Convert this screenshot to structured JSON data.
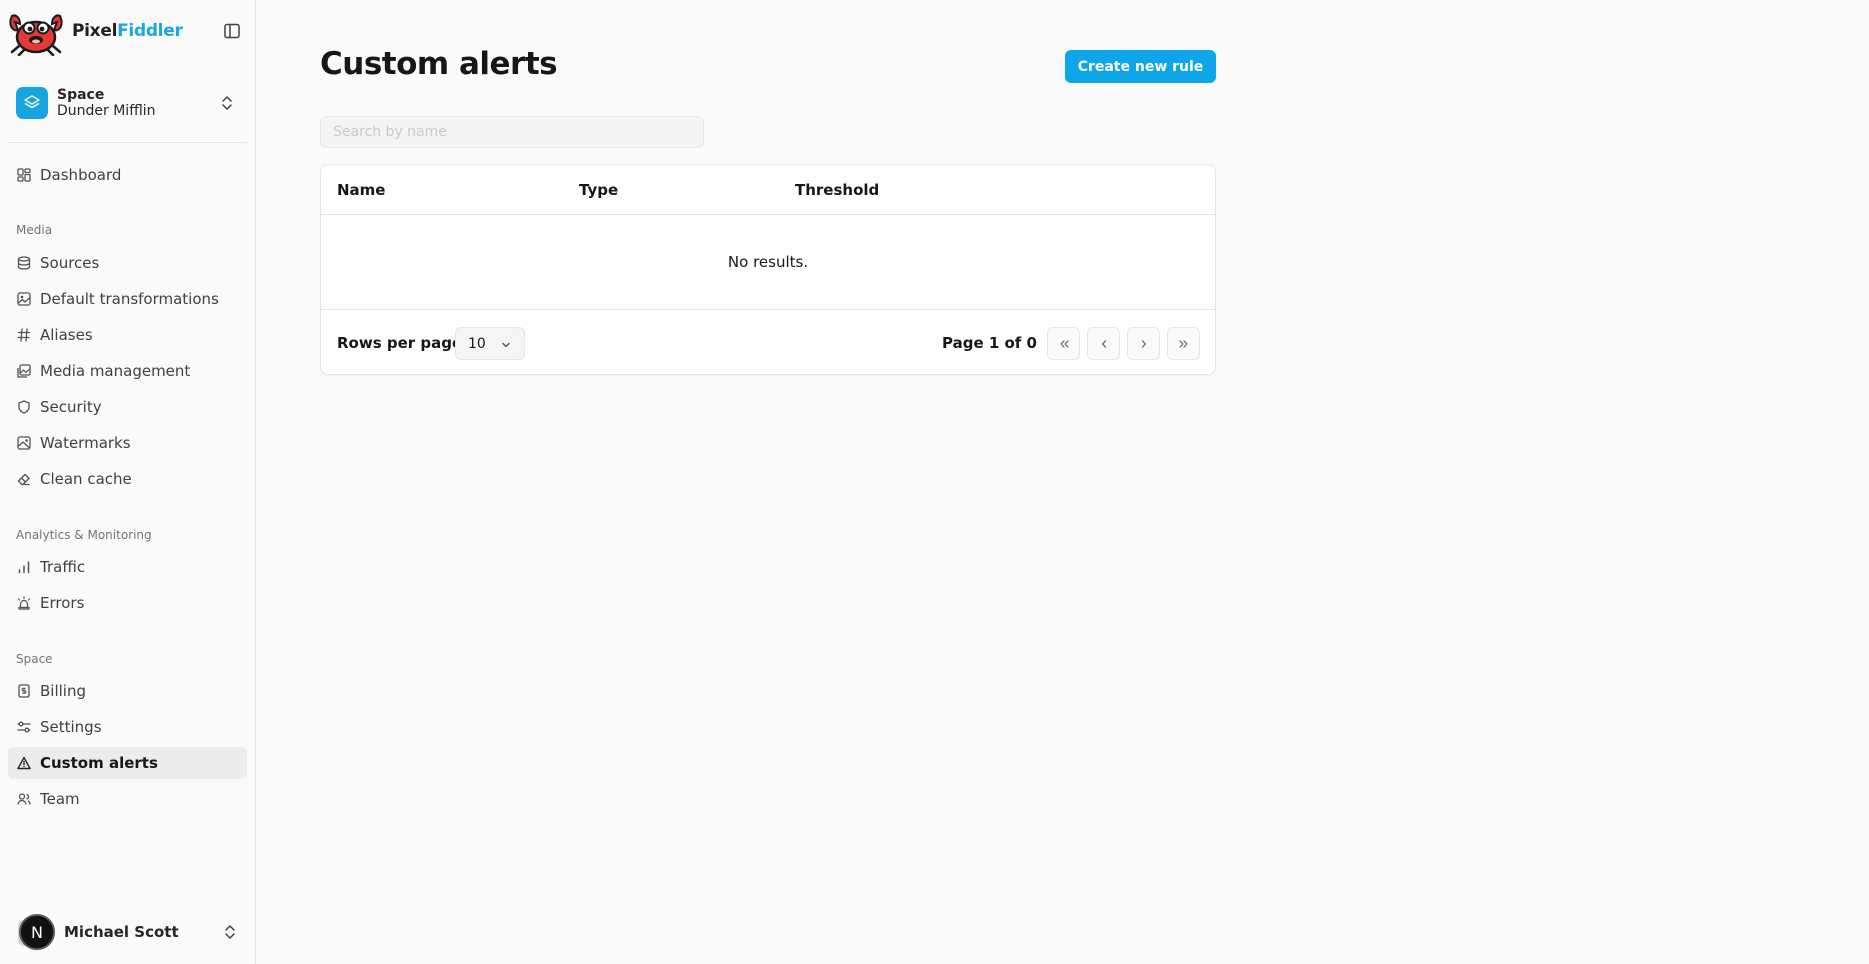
{
  "brand": {
    "name_part1": "Pixel",
    "name_part2": "Fiddler"
  },
  "space": {
    "label": "Space",
    "name": "Dunder Mifflin"
  },
  "nav": {
    "dashboard": {
      "label": "Dashboard",
      "icon": "dashboard-icon"
    },
    "groups": [
      {
        "label": "Media",
        "items": [
          {
            "label": "Sources",
            "icon": "database-icon"
          },
          {
            "label": "Default transformations",
            "icon": "image-transform-icon"
          },
          {
            "label": "Aliases",
            "icon": "hash-icon"
          },
          {
            "label": "Media management",
            "icon": "images-icon"
          },
          {
            "label": "Security",
            "icon": "shield-icon"
          },
          {
            "label": "Watermarks",
            "icon": "image-watermark-icon"
          },
          {
            "label": "Clean cache",
            "icon": "eraser-icon"
          }
        ]
      },
      {
        "label": "Analytics & Monitoring",
        "items": [
          {
            "label": "Traffic",
            "icon": "bar-chart-icon"
          },
          {
            "label": "Errors",
            "icon": "siren-icon"
          }
        ]
      },
      {
        "label": "Space",
        "items": [
          {
            "label": "Billing",
            "icon": "receipt-icon"
          },
          {
            "label": "Settings",
            "icon": "sliders-icon"
          },
          {
            "label": "Custom alerts",
            "icon": "alert-triangle-icon",
            "active": true
          },
          {
            "label": "Team",
            "icon": "users-icon"
          }
        ]
      }
    ]
  },
  "user": {
    "name": "Michael Scott",
    "avatar_letter": "N"
  },
  "page": {
    "title": "Custom alerts",
    "create_button": "Create new rule",
    "search_placeholder": "Search by name",
    "search_value": ""
  },
  "table": {
    "columns": [
      "Name",
      "Type",
      "Threshold"
    ],
    "empty_text": "No results.",
    "rows_per_page_label": "Rows per page",
    "rows_per_page_value": "10",
    "page_info": "Page 1 of 0"
  },
  "colors": {
    "accent": "#0ea5e9",
    "brand_blue": "#1aa7e0",
    "active_bg": "#ececec"
  }
}
